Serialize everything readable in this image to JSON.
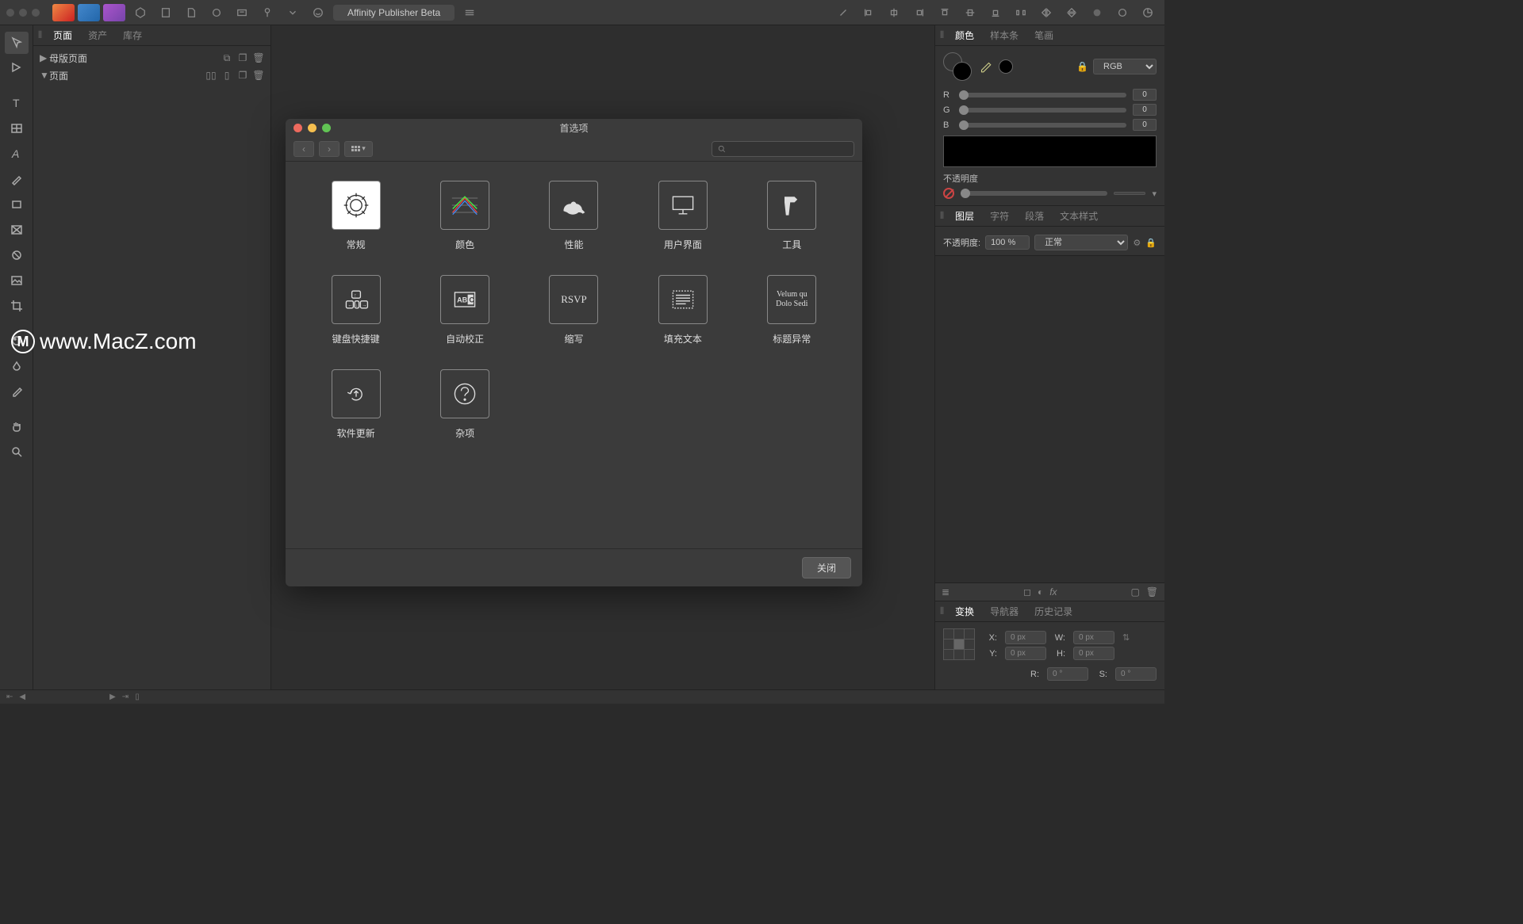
{
  "app": {
    "title": "Affinity Publisher Beta"
  },
  "left_panel": {
    "tabs": [
      "页面",
      "资产",
      "库存"
    ],
    "tree": [
      {
        "label": "母版页面",
        "arrow": "▶"
      },
      {
        "label": "页面",
        "arrow": "▼"
      }
    ]
  },
  "right_panel": {
    "color_tabs": [
      "颜色",
      "样本条",
      "笔画"
    ],
    "color_mode": "RGB",
    "sliders": {
      "R": "0",
      "G": "0",
      "B": "0"
    },
    "opacity_label": "不透明度",
    "layer_tabs": [
      "图层",
      "字符",
      "段落",
      "文本样式"
    ],
    "layer_opacity_label": "不透明度:",
    "layer_opacity_value": "100 %",
    "blend_mode": "正常",
    "transform_tabs": [
      "变换",
      "导航器",
      "历史记录"
    ],
    "transform": {
      "x_label": "X:",
      "x": "0 px",
      "y_label": "Y:",
      "y": "0 px",
      "w_label": "W:",
      "w": "0 px",
      "h_label": "H:",
      "h": "0 px",
      "r_label": "R:",
      "r": "0 °",
      "s_label": "S:",
      "s": "0 °"
    }
  },
  "dialog": {
    "title": "首选项",
    "close": "关闭",
    "items": [
      {
        "label": "常规",
        "icon": "gear"
      },
      {
        "label": "颜色",
        "icon": "color"
      },
      {
        "label": "性能",
        "icon": "perf"
      },
      {
        "label": "用户界面",
        "icon": "ui"
      },
      {
        "label": "工具",
        "icon": "tools"
      },
      {
        "label": "键盘快捷键",
        "icon": "keys"
      },
      {
        "label": "自动校正",
        "icon": "autoc"
      },
      {
        "label": "缩写",
        "icon": "rsvp"
      },
      {
        "label": "填充文本",
        "icon": "fill"
      },
      {
        "label": "标题异常",
        "icon": "title"
      },
      {
        "label": "软件更新",
        "icon": "update"
      },
      {
        "label": "杂项",
        "icon": "misc"
      }
    ]
  },
  "watermark": "www.MacZ.com"
}
